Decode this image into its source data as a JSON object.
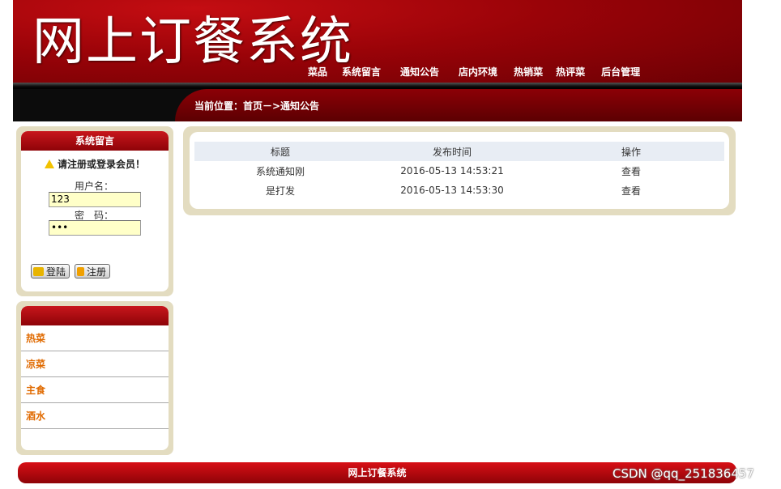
{
  "header": {
    "site_title": "网上订餐系统",
    "nav": [
      "菜品",
      "系统留言",
      "通知公告",
      "店内环境",
      "热销菜",
      "热评菜",
      "后台管理"
    ]
  },
  "breadcrumb": "当前位置：首页－>通知公告",
  "login": {
    "title": "系统留言",
    "prompt": "请注册或登录会员！",
    "username_label": "用户名：",
    "username_value": "123",
    "password_label": "密　码：",
    "password_value": "•••",
    "login_button": "登陆",
    "register_button": "注册"
  },
  "categories": {
    "title": "",
    "items": [
      "热菜",
      "凉菜",
      "主食",
      "酒水"
    ]
  },
  "notices": {
    "columns": [
      "标题",
      "发布时间",
      "操作"
    ],
    "rows": [
      {
        "title": "系统通知刚",
        "time": "2016-05-13 14:53:21",
        "action": "查看"
      },
      {
        "title": "是打发",
        "time": "2016-05-13 14:53:30",
        "action": "查看"
      }
    ]
  },
  "footer": "网上订餐系统",
  "watermark": "CSDN @qq_251836457",
  "colors": {
    "brand_red": "#a8060b",
    "panel_beige": "#e3dcc0",
    "category_orange": "#e06a00"
  }
}
